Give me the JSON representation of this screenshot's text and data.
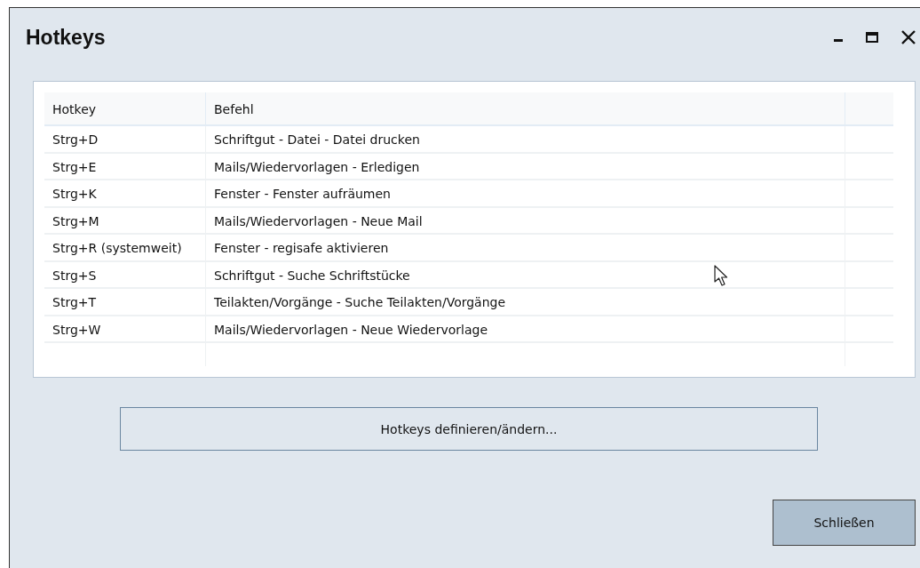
{
  "window": {
    "title": "Hotkeys"
  },
  "table": {
    "columns": [
      "Hotkey",
      "Befehl"
    ],
    "rows": [
      {
        "hotkey": "Strg+D",
        "command": "Schriftgut - Datei - Datei drucken"
      },
      {
        "hotkey": "Strg+E",
        "command": "Mails/Wiedervorlagen - Erledigen"
      },
      {
        "hotkey": "Strg+K",
        "command": "Fenster - Fenster aufräumen"
      },
      {
        "hotkey": "Strg+M",
        "command": "Mails/Wiedervorlagen - Neue Mail"
      },
      {
        "hotkey": "Strg+R (systemweit)",
        "command": "Fenster - regisafe aktivieren"
      },
      {
        "hotkey": "Strg+S",
        "command": "Schriftgut - Suche Schriftstücke"
      },
      {
        "hotkey": "Strg+T",
        "command": "Teilakten/Vorgänge - Suche Teilakten/Vorgänge"
      },
      {
        "hotkey": "Strg+W",
        "command": "Mails/Wiedervorlagen - Neue Wiedervorlage"
      }
    ]
  },
  "buttons": {
    "define": "Hotkeys definieren/ändern...",
    "close": "Schließen"
  }
}
